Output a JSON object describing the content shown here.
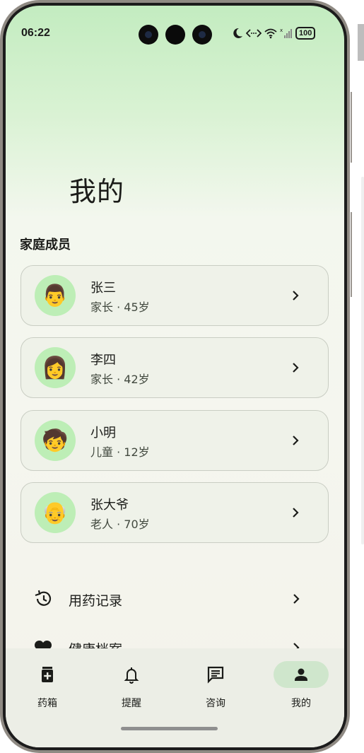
{
  "status_bar": {
    "time": "06:22",
    "battery": "100"
  },
  "page": {
    "title": "我的"
  },
  "family": {
    "section_title": "家庭成员",
    "members": [
      {
        "name": "张三",
        "role": "家长",
        "age": "45岁",
        "avatar": "👨",
        "avatar_icon": "man-emoji-icon"
      },
      {
        "name": "李四",
        "role": "家长",
        "age": "42岁",
        "avatar": "👩",
        "avatar_icon": "woman-emoji-icon"
      },
      {
        "name": "小明",
        "role": "儿童",
        "age": "12岁",
        "avatar": "🧒",
        "avatar_icon": "child-emoji-icon"
      },
      {
        "name": "张大爷",
        "role": "老人",
        "age": "70岁",
        "avatar": "👴",
        "avatar_icon": "old-man-emoji-icon"
      }
    ],
    "separator": "·"
  },
  "menu": [
    {
      "label": "用药记录",
      "icon": "history-icon"
    },
    {
      "label": "健康档案",
      "icon": "heart-icon"
    }
  ],
  "bottom_nav": [
    {
      "label": "药箱",
      "icon": "medicine-box-icon",
      "active": false
    },
    {
      "label": "提醒",
      "icon": "bell-icon",
      "active": false
    },
    {
      "label": "咨询",
      "icon": "chat-icon",
      "active": false
    },
    {
      "label": "我的",
      "icon": "person-icon",
      "active": true
    }
  ],
  "colors": {
    "accent_pill": "#cfe6cc",
    "avatar_bg": "#bdeeb6",
    "card_bg": "#eff2e9"
  }
}
